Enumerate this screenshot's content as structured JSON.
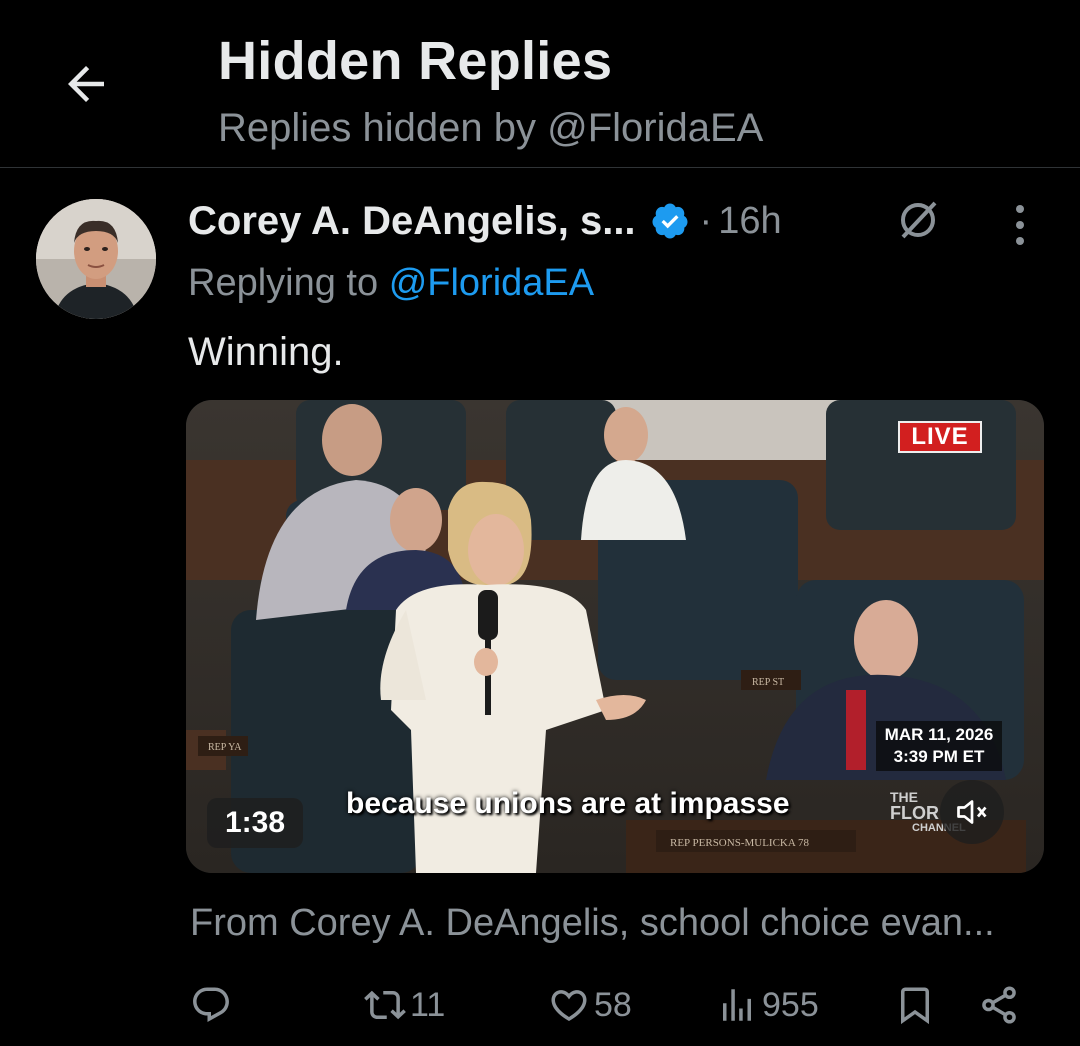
{
  "header": {
    "title": "Hidden Replies",
    "subtitle": "Replies hidden by @FloridaEA"
  },
  "tweet": {
    "author_name": "Corey A. DeAngelis, s...",
    "verified": true,
    "separator": "·",
    "time": "16h",
    "replying_prefix": "Replying to",
    "replying_handle": "@FloridaEA",
    "text": "Winning.",
    "media": {
      "live_label": "LIVE",
      "date": "MAR 11, 2026",
      "clock": "3:39 PM ET",
      "caption": "because unions are at impasse",
      "duration": "1:38",
      "channel_small": "THE",
      "channel_big": "FLOR",
      "channel_sub": "CHANNEL",
      "nameplate_1": "REP PERSONS-MULICKA 78",
      "nameplate_2": "REP ST",
      "nameplate_3": "REP YA"
    },
    "from_line": "From Corey A. DeAngelis, school choice evan...",
    "actions": {
      "reply_count": "",
      "retweet_count": "11",
      "like_count": "58",
      "view_count": "955"
    }
  },
  "colors": {
    "background": "#000000",
    "text": "#e7e9ea",
    "muted": "#8b9298",
    "link": "#1d9bf0",
    "live_red": "#d21f1f"
  },
  "icons": [
    "back-arrow-icon",
    "verified-badge-icon",
    "hidden-reply-icon",
    "more-vertical-icon",
    "reply-icon",
    "retweet-icon",
    "like-icon",
    "views-icon",
    "bookmark-icon",
    "share-icon",
    "mute-icon"
  ]
}
